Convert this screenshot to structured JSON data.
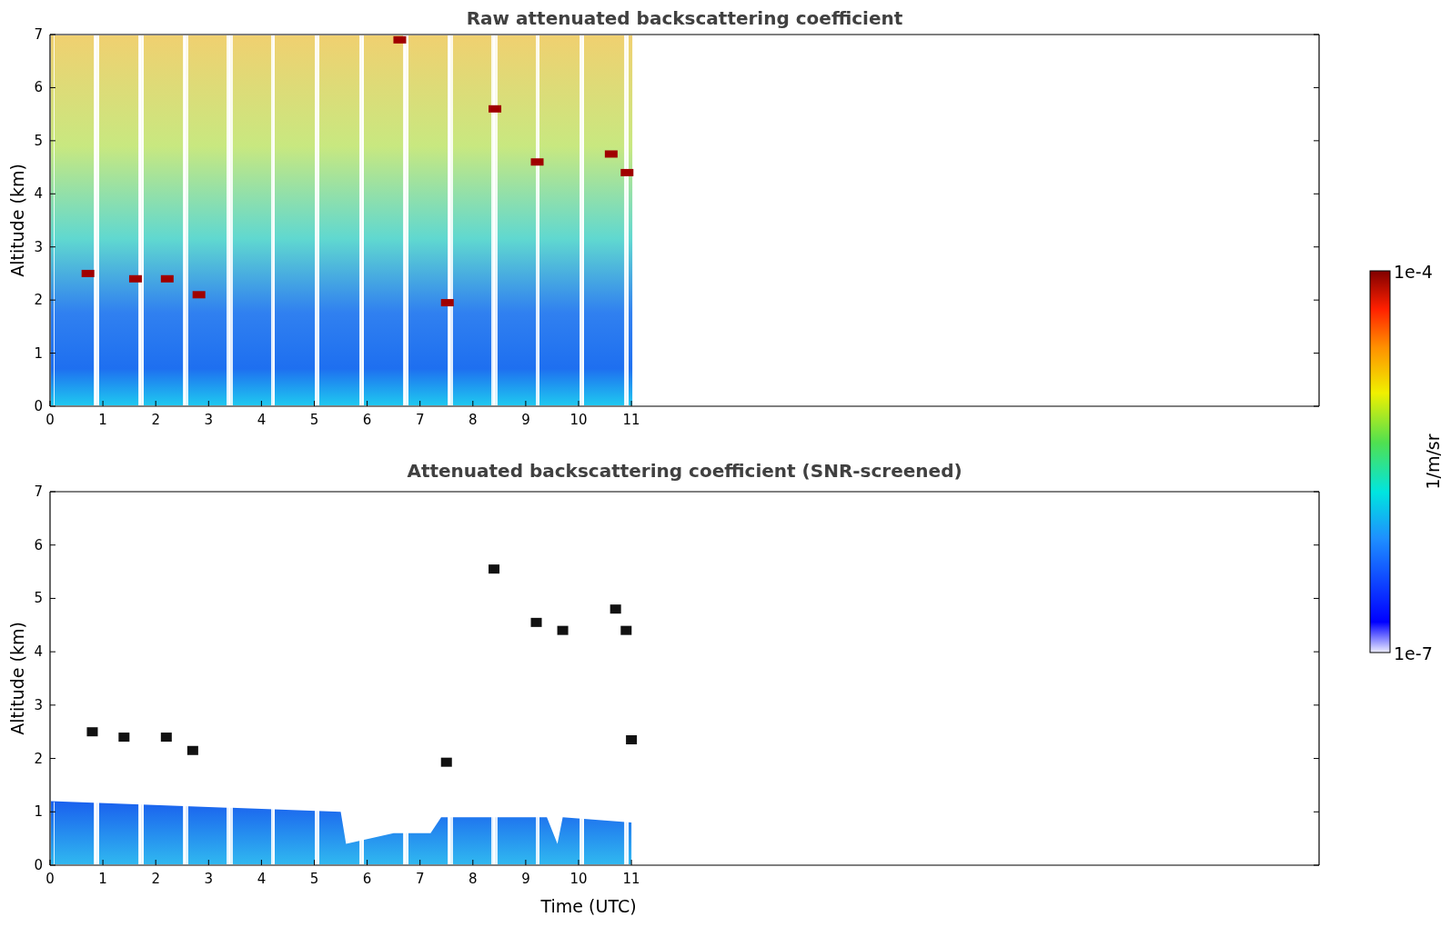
{
  "panels": [
    {
      "kind": "raw",
      "title": "Raw attenuated backscattering coefficient",
      "ylabel": "Altitude (km)",
      "xticks": [
        "0",
        "1",
        "2",
        "3",
        "4",
        "5",
        "6",
        "7",
        "8",
        "9",
        "10",
        "11"
      ],
      "yticks": [
        "7",
        "6",
        "5",
        "4",
        "3",
        "2",
        "1",
        "0"
      ]
    },
    {
      "kind": "screened",
      "title": "Attenuated backscattering coefficient (SNR-screened)",
      "ylabel": "Altitude (km)",
      "xlabel": "Time (UTC)",
      "xticks": [
        "0",
        "1",
        "2",
        "3",
        "4",
        "5",
        "6",
        "7",
        "8",
        "9",
        "10",
        "11"
      ],
      "yticks": [
        "7",
        "6",
        "5",
        "4",
        "3",
        "2",
        "1",
        "0"
      ]
    }
  ],
  "colorbar": {
    "max_label": "1e-4",
    "min_label": "1e-7",
    "unit": "1/m/sr"
  }
}
